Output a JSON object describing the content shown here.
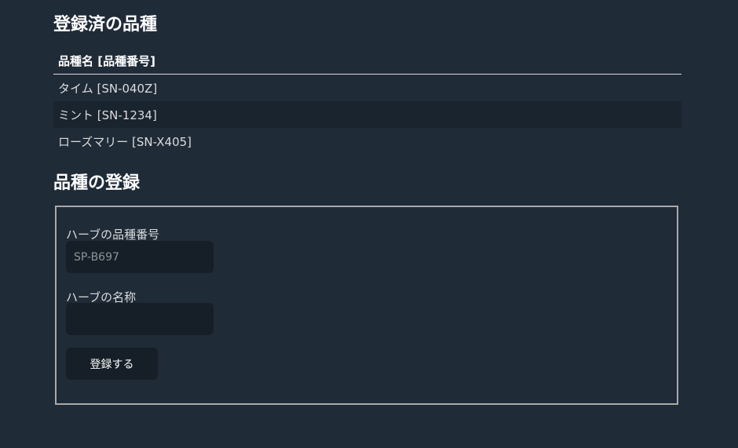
{
  "registered": {
    "title": "登録済の品種",
    "header": "品種名 [品種番号]",
    "rows": [
      "タイム [SN-040Z]",
      "ミント [SN-1234]",
      "ローズマリー [SN-X405]"
    ]
  },
  "register": {
    "title": "品種の登録",
    "number_label": "ハーブの品種番号",
    "number_placeholder": "SP-B697",
    "number_value": "",
    "name_label": "ハーブの名称",
    "name_placeholder": "",
    "name_value": "",
    "submit_label": "登録する"
  }
}
